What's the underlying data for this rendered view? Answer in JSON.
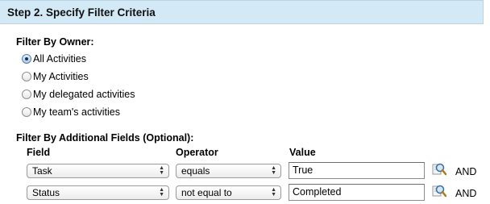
{
  "step": {
    "title": "Step 2. Specify Filter Criteria"
  },
  "owner_filter": {
    "label": "Filter By Owner:",
    "options": [
      {
        "label": "All Activities",
        "selected": true
      },
      {
        "label": "My Activities",
        "selected": false
      },
      {
        "label": "My delegated activities",
        "selected": false
      },
      {
        "label": "My team's activities",
        "selected": false
      }
    ]
  },
  "additional_fields": {
    "label": "Filter By Additional Fields (Optional):",
    "headers": {
      "field": "Field",
      "operator": "Operator",
      "value": "Value"
    },
    "rows": [
      {
        "field": "Task",
        "operator": "equals",
        "value": "True",
        "conjunction": "AND"
      },
      {
        "field": "Status",
        "operator": "not equal to",
        "value": "Completed",
        "conjunction": "AND"
      }
    ]
  },
  "icons": {
    "lookup": "lookup-magnifier-icon",
    "select_arrows": "chevron-updown-icon"
  }
}
